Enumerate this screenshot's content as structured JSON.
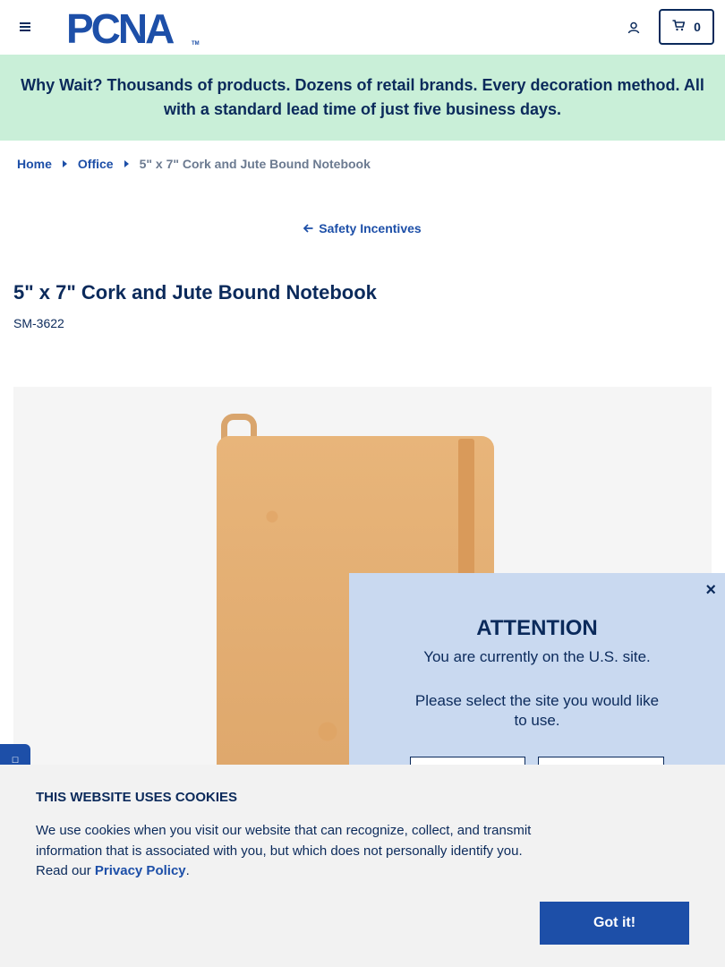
{
  "header": {
    "logo_text": "PCNA",
    "cart_count": "0",
    "menu_icon": "hamburger-menu-icon",
    "account_icon": "user-icon",
    "cart_icon": "cart-icon"
  },
  "banner": {
    "text": "Why Wait? Thousands of products. Dozens of retail brands. Every decoration method. All with a standard lead time of just five business days."
  },
  "breadcrumb": {
    "items": [
      "Home",
      "Office"
    ],
    "current": "5\" x 7\" Cork and Jute Bound Notebook"
  },
  "back_link": {
    "label": "Safety Incentives"
  },
  "product": {
    "title": "5\" x 7\" Cork and Jute Bound Notebook",
    "sku": "SM-3622"
  },
  "attention": {
    "title": "ATTENTION",
    "line1": "You are currently on the U.S. site.",
    "line2": "Please select the site you would like to use.",
    "close_label": "×"
  },
  "cookie": {
    "title": "THIS WEBSITE USES COOKIES",
    "body": "We use cookies when you visit our website that can recognize, collect, and transmit information that is associated with you, but which does not personally identify you. Read our",
    "link": "Privacy Policy",
    "after_link": ".",
    "button": "Got it!"
  },
  "colors": {
    "navy": "#0b2a5b",
    "link_blue": "#1d4fa8",
    "banner_green": "#c9efd8",
    "modal_blue": "#c9d9f0"
  }
}
